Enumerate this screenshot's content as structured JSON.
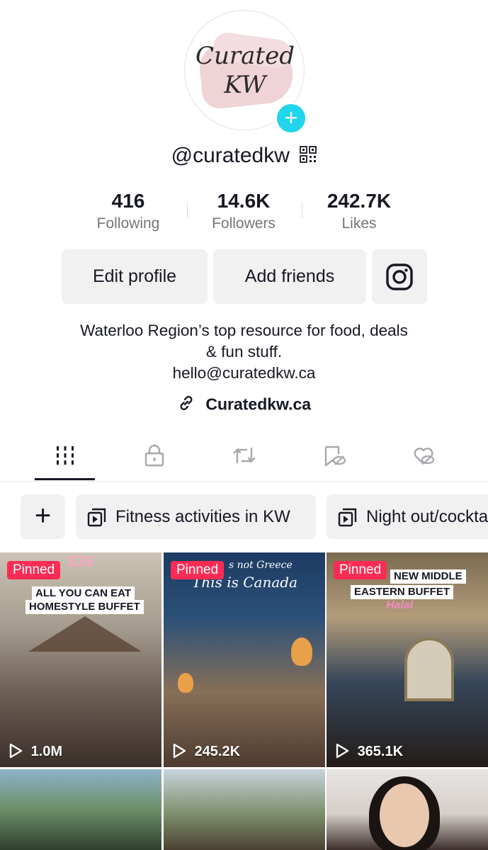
{
  "profile": {
    "avatar_text_line1": "Curated",
    "avatar_text_line2": "KW",
    "username": "@curatedkw",
    "stats": [
      {
        "value": "416",
        "label": "Following"
      },
      {
        "value": "14.6K",
        "label": "Followers"
      },
      {
        "value": "242.7K",
        "label": "Likes"
      }
    ],
    "buttons": {
      "edit_profile": "Edit profile",
      "add_friends": "Add friends"
    },
    "bio_line1": "Waterloo Region’s top resource for food, deals",
    "bio_line2": "& fun stuff.",
    "bio_email": "hello@curatedkw.ca",
    "link": "Curatedkw.ca"
  },
  "tabs": [
    {
      "icon": "videos-grid-icon",
      "active": true
    },
    {
      "icon": "private-lock-icon",
      "active": false
    },
    {
      "icon": "reposts-icon",
      "active": false
    },
    {
      "icon": "favorites-hidden-icon",
      "active": false
    },
    {
      "icon": "liked-hidden-icon",
      "active": false
    }
  ],
  "playlists": [
    {
      "label": "Fitness activities in KW"
    },
    {
      "label": "Night out/cocktails"
    }
  ],
  "videos": [
    {
      "pinned": "Pinned",
      "views": "1.0M",
      "overlay_price": "$36",
      "overlay_line1": "ALL YOU CAN EAT",
      "overlay_line2": "HOMESTYLE BUFFET"
    },
    {
      "pinned": "Pinned",
      "views": "245.2K",
      "overlay_line1": "s not Greece",
      "overlay_line2": "This is Canada"
    },
    {
      "pinned": "Pinned",
      "views": "365.1K",
      "overlay_line1": "NEW MIDDLE",
      "overlay_line2": "EASTERN BUFFET",
      "overlay_tag": "Halal"
    }
  ],
  "colors": {
    "accent": "#fe2c55",
    "plus_badge": "#20d5ec",
    "button_bg": "#f1f1f2",
    "text_primary": "#161823",
    "text_secondary": "#75767c"
  }
}
